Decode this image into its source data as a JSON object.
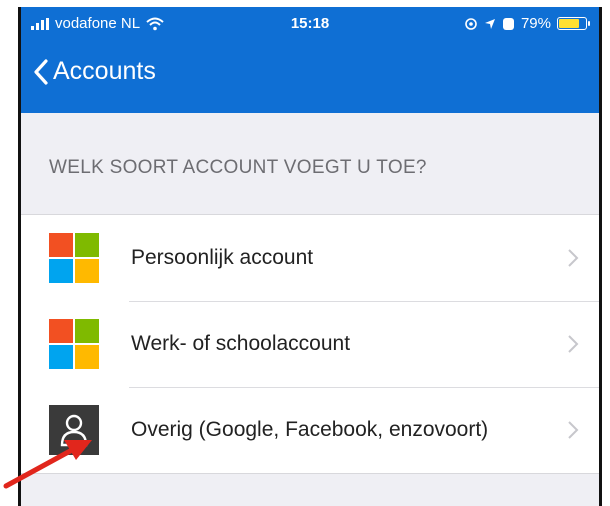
{
  "status_bar": {
    "carrier": "vodafone NL",
    "time": "15:18",
    "battery": "79%",
    "battery_level": 0.79,
    "icons": [
      "signal-icon",
      "wifi-icon",
      "location-icon",
      "alarm-icon",
      "battery-icon"
    ]
  },
  "nav": {
    "back_label": "Accounts",
    "back_icon": "chevron-left-icon"
  },
  "section_title": "WELK SOORT ACCOUNT VOEGT U TOE?",
  "items": [
    {
      "label": "Persoonlijk account",
      "icon": "microsoft-logo-icon"
    },
    {
      "label": "Werk- of schoolaccount",
      "icon": "microsoft-logo-icon"
    },
    {
      "label": "Overig (Google, Facebook, enzovoort)",
      "icon": "person-icon"
    }
  ],
  "colors": {
    "header": "#0f6fd4",
    "background": "#efeff4",
    "ms_red": "#f25022",
    "ms_green": "#7fba00",
    "ms_blue": "#00a4ef",
    "ms_yellow": "#ffb900",
    "annotation_arrow": "#e1261c"
  },
  "annotation": {
    "type": "arrow",
    "points_to": "items.2.icon"
  }
}
